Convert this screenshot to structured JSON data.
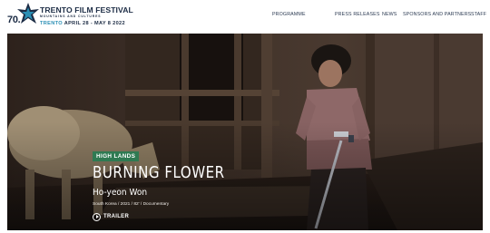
{
  "header": {
    "logo": {
      "edition": "70.",
      "title": "TRENTO FILM FESTIVAL",
      "subtitle": "MOUNTAINS AND CULTURES",
      "location": "TRENTO",
      "dates": "APRIL 28 - MAY 8 2022"
    },
    "nav": [
      {
        "label": "PROGRAMME"
      },
      {
        "label": "PRESS RELEASES"
      },
      {
        "label": "NEWS"
      },
      {
        "label": "SPONSORS AND PARTNERS"
      },
      {
        "label": "STAFF"
      }
    ]
  },
  "hero": {
    "section_tag": "HIGH LANDS",
    "film_title": "BURNING FLOWER",
    "director": "Ho-yeon Won",
    "meta": "South Korea  /  2021  /  82'  /  Documentary",
    "trailer_label": "TRAILER"
  },
  "colors": {
    "brand_navy": "#1b2b44",
    "brand_blue": "#2a8fb5",
    "tag_green": "#2f7a52"
  }
}
